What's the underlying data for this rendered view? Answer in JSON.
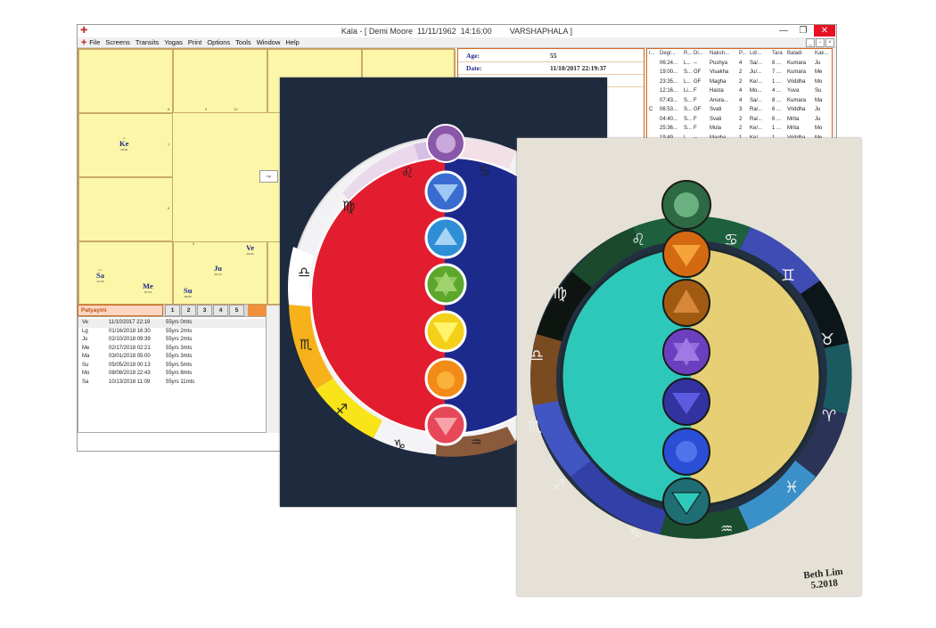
{
  "window": {
    "title": "Kala - [ Demi Moore  11/11/1962  14:16:00        VARSHAPHALA ]",
    "menu": [
      "File",
      "Screens",
      "Transits",
      "Yogas",
      "Print",
      "Options",
      "Tools",
      "Window",
      "Help"
    ]
  },
  "chart": {
    "planets": [
      {
        "abbr": "Ke",
        "deg": "29:49",
        "sup": "Sa"
      },
      {
        "abbr": "Sa",
        "deg": "25:26",
        "sup": "Mc"
      },
      {
        "abbr": "Me",
        "deg": "07:43",
        "sup": ""
      },
      {
        "abbr": "Su",
        "deg": "09:00",
        "sup": ""
      },
      {
        "abbr": "Ju",
        "deg": "06:53",
        "sup": ""
      },
      {
        "abbr": "Ve",
        "deg": "04:40",
        "sup": ""
      }
    ],
    "house_numbers": [
      "8",
      "9",
      "10",
      "7",
      "6",
      "5"
    ],
    "center_button": "Up"
  },
  "info": {
    "rows": [
      {
        "key": "Age:",
        "value": "55"
      },
      {
        "key": "Date:",
        "value": "11/10/2017  22:19:37"
      },
      {
        "key": "Muntha:",
        "value": ""
      }
    ]
  },
  "table": {
    "headers": [
      "r...",
      "Degr...",
      "R...",
      "Di...",
      "Naksh...",
      "P...",
      "Ld/...",
      "Tara",
      "Baladi",
      "Kak..."
    ],
    "rows": [
      [
        "",
        "06:24...",
        "L...",
        "--",
        "Pushya",
        "4",
        "Sa/...",
        "8 ...",
        "Kumara",
        "Ju"
      ],
      [
        "",
        "19:00...",
        "S...",
        "GF",
        "Visakha",
        "2",
        "Ju/...",
        "7 ...",
        "Kumara",
        "Me"
      ],
      [
        "",
        "23:35...",
        "L...",
        "GF",
        "Magha",
        "2",
        "Ke/...",
        "1 ...",
        "Vriddha",
        "Mo"
      ],
      [
        "",
        "12:16...",
        "Li...",
        "F",
        "Hasta",
        "4",
        "Mo...",
        "4 ...",
        "Yuva",
        "Su"
      ],
      [
        "",
        "07:43...",
        "S...",
        "F",
        "Anura...",
        "4",
        "Sa/...",
        "8 ...",
        "Kumara",
        "Ma"
      ],
      [
        "C",
        "06:53...",
        "S...",
        "GF",
        "Svati",
        "3",
        "Ra/...",
        "6 ...",
        "Vriddha",
        "Ju"
      ],
      [
        "",
        "04:40...",
        "S...",
        "F",
        "Svati",
        "2",
        "Ra/...",
        "6 ...",
        "Mrita",
        "Ju"
      ],
      [
        "",
        "25:36...",
        "S...",
        "F",
        "Mula",
        "2",
        "Ke/...",
        "1 ...",
        "Mrita",
        "Mo"
      ],
      [
        "",
        "19:49...",
        "L...",
        "--",
        "Magha",
        "1",
        "Ke/...",
        "1 ...",
        "Vriddha",
        "Me..."
      ]
    ]
  },
  "dasa": {
    "label": "Patyayini",
    "tabs": [
      "1",
      "2",
      "3",
      "4",
      "5"
    ],
    "rows": [
      [
        "Ve",
        "11/10/2017  22:19",
        "55yrs 0mts"
      ],
      [
        "Lg",
        "01/16/2018  16:30",
        "55yrs 2mts"
      ],
      [
        "Ju",
        "02/10/2018  09:39",
        "55yrs 2mts"
      ],
      [
        "Me",
        "02/17/2018  02:21",
        "55yrs 3mts"
      ],
      [
        "Ma",
        "03/01/2018  05:00",
        "55yrs 3mts"
      ],
      [
        "Su",
        "05/05/2018  00:13",
        "55yrs 5mts"
      ],
      [
        "Mo",
        "08/08/2018  22:43",
        "55yrs 8mts"
      ],
      [
        "Sa",
        "10/13/2018  11:09",
        "55yrs 11mts"
      ]
    ]
  },
  "taskbar_icons": [
    "windows-start-icon",
    "internet-explorer-icon",
    "chrome-icon",
    "firefox-icon",
    "media-player-icon",
    "skype-icon",
    "powerpoint-icon"
  ],
  "painting2": {
    "signature": "Beth Lim",
    "signature_date": "5.2018"
  },
  "colors": {
    "chart_bg": "#fbf6a8",
    "accent_orange": "#d46a1b",
    "planet_blue": "#1f2a8a",
    "taskbar": "#1b3f93",
    "close_red": "#e81123"
  }
}
